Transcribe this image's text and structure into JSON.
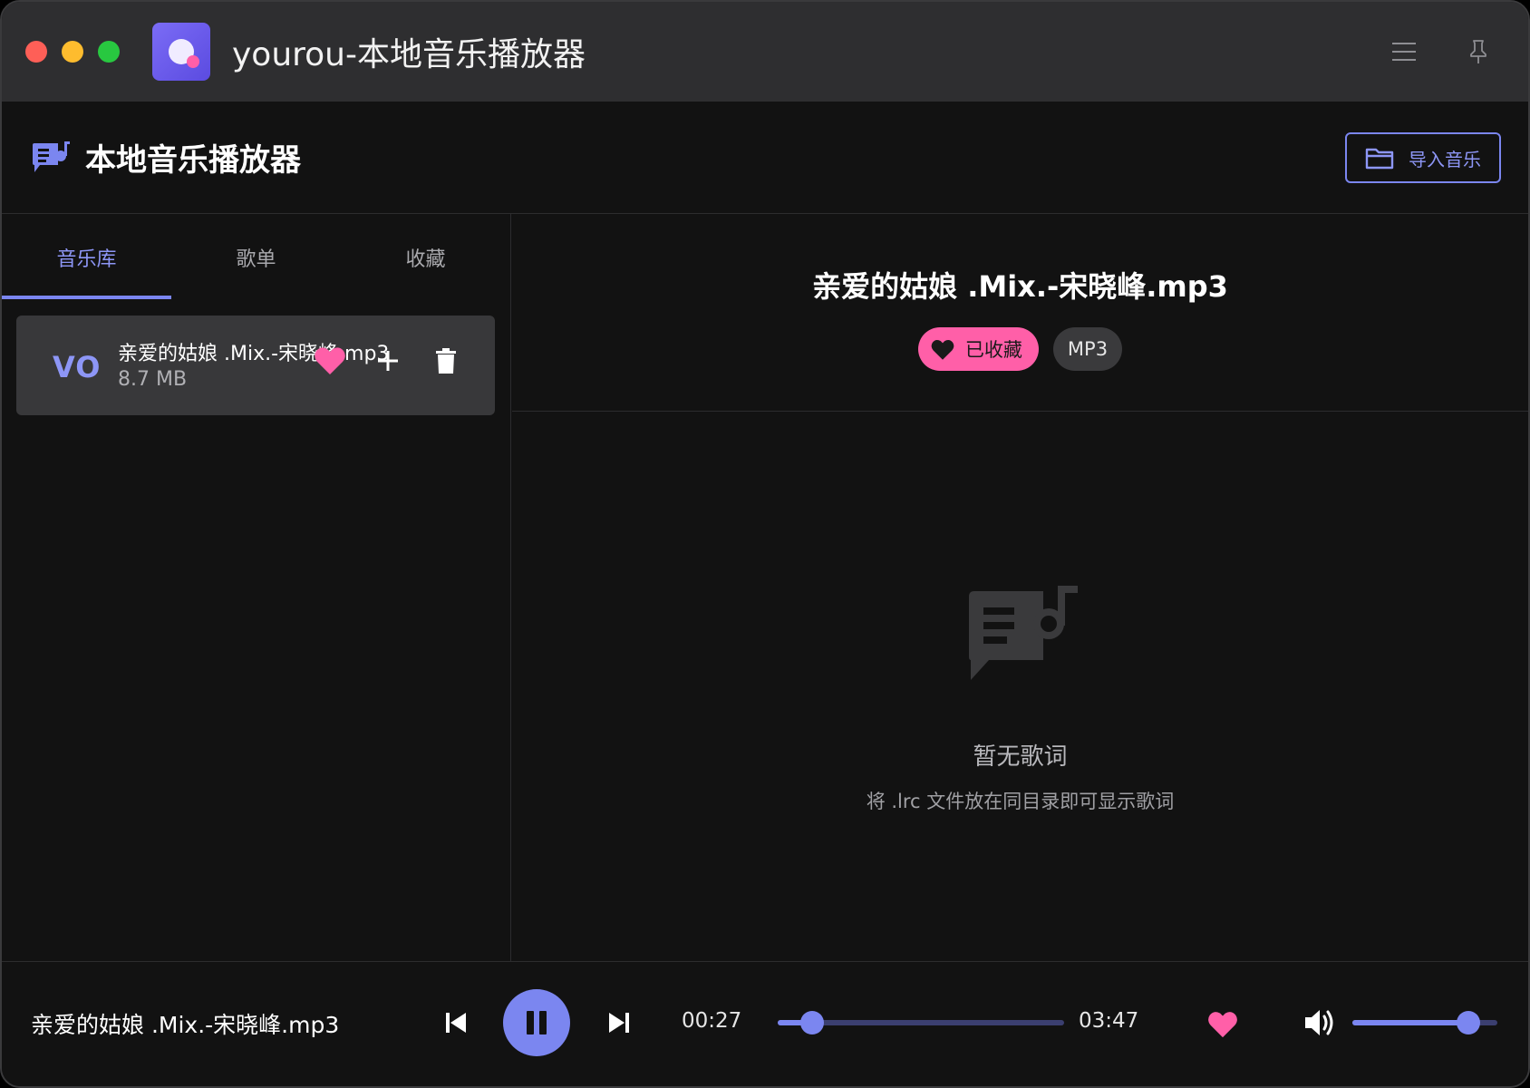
{
  "window": {
    "title": "yourou-本地音乐播放器"
  },
  "header": {
    "title": "本地音乐播放器",
    "import_label": "导入音乐"
  },
  "tabs": [
    {
      "label": "音乐库",
      "active": true
    },
    {
      "label": "歌单",
      "active": false
    },
    {
      "label": "收藏",
      "active": false
    }
  ],
  "library": [
    {
      "badge": "VO",
      "name": "亲爱的姑娘 .Mix.-宋晓峰.mp3",
      "size": "8.7 MB",
      "favorited": true
    }
  ],
  "now_playing": {
    "title": "亲爱的姑娘 .Mix.-宋晓峰.mp3",
    "fav_chip": "已收藏",
    "format_chip": "MP3"
  },
  "lyrics": {
    "empty_title": "暂无歌词",
    "empty_hint": "将 .lrc 文件放在同目录即可显示歌词"
  },
  "player": {
    "title": "亲爱的姑娘 .Mix.-宋晓峰.mp3",
    "current_time": "00:27",
    "duration": "03:47",
    "progress": 0.12,
    "volume": 0.8,
    "is_playing": true,
    "favorited": true
  },
  "colors": {
    "accent": "#7b86f0",
    "favorite": "#ff5fa8",
    "background": "#121212",
    "titlebar": "#2e2e30"
  },
  "icons": {
    "menu": "hamburger-menu-icon",
    "pin": "pin-icon",
    "lyrics": "lyrics-note-icon",
    "folder": "folder-icon",
    "heart": "heart-icon",
    "add": "plus-icon",
    "delete": "trash-icon",
    "prev": "skip-previous-icon",
    "pause": "pause-icon",
    "next": "skip-next-icon",
    "volume": "volume-icon"
  }
}
